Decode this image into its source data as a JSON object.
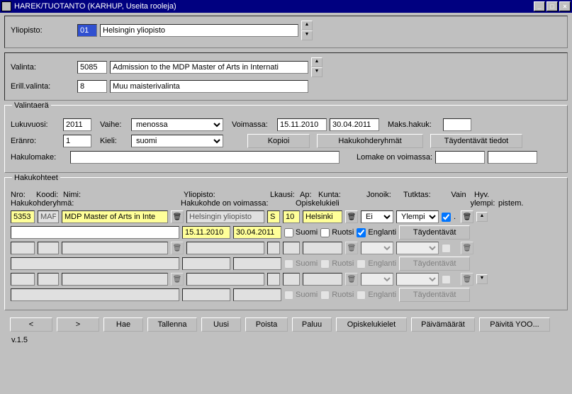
{
  "window": {
    "title": "HAREK/TUOTANTO   (KARHUP, Useita rooleja)"
  },
  "top": {
    "yliopisto_lbl": "Yliopisto:",
    "yliopisto_code": "01",
    "yliopisto_name": "Helsingin yliopisto",
    "valinta_lbl": "Valinta:",
    "valinta_code": "5085",
    "valinta_name": "Admission to the MDP Master of Arts in Internati",
    "erill_lbl": "Erill.valinta:",
    "erill_code": "8",
    "erill_name": "Muu maisterivalinta"
  },
  "valintaera": {
    "legend": "Valintaerä",
    "lukuvuosi_lbl": "Lukuvuosi:",
    "lukuvuosi": "2011",
    "vaihe_lbl": "Vaihe:",
    "vaihe": "menossa",
    "voimassa_lbl": "Voimassa:",
    "voimassa_from": "15.11.2010",
    "voimassa_to": "30.04.2011",
    "maks_lbl": "Maks.hakuk:",
    "maks": "",
    "eranro_lbl": "Eränro:",
    "eranro": "1",
    "kieli_lbl": "Kieli:",
    "kieli": "suomi",
    "kopioi": "Kopioi",
    "hakukohderyhmat": "Hakukohderyhmät",
    "taydentavat": "Täydentävät tiedot",
    "hakulomake_lbl": "Hakulomake:",
    "hakulomake": "",
    "lomake_lbl": "Lomake on voimassa:"
  },
  "hakukohteet": {
    "legend": "Hakukohteet",
    "hdr": {
      "nro": "Nro:",
      "koodi": "Koodi:",
      "nimi": "Nimi:",
      "yliopisto": "Yliopisto:",
      "lkausi": "Lkausi:",
      "ap": "Ap:",
      "kunta": "Kunta:",
      "jonoik": "Jonoik:",
      "tutktas": "Tutktas:",
      "vain": "Vain",
      "ylempi": "ylempi:",
      "hyv": "Hyv.",
      "pistem": "pistem."
    },
    "sub": {
      "hakukohderyhma": "Hakukohderyhmä:",
      "hakukohde_voim": "Hakukohde on voimassa:",
      "opiskelukieli": "Opiskelukieli"
    },
    "row1": {
      "nro": "5353",
      "koodi": "MAP",
      "nimi": "MDP Master of Arts in Inte",
      "yliopisto": "Helsingin yliopisto",
      "lkausi": "S",
      "ap": "10",
      "kunta": "Helsinki",
      "jonoik": "Ei",
      "tutktas": "Ylempi"
    },
    "row2": {
      "from": "15.11.2010",
      "to": "30.04.2011",
      "suomi": "Suomi",
      "ruotsi": "Ruotsi",
      "englanti": "Englanti",
      "tayd": "Täydentävät"
    },
    "disabled": {
      "suomi": "Suomi",
      "ruotsi": "Ruotsi",
      "englanti": "Englanti",
      "tayd": "Täydentävät"
    }
  },
  "bottom": {
    "prev": "<",
    "next": ">",
    "hae": "Hae",
    "tallenna": "Tallenna",
    "uusi": "Uusi",
    "poista": "Poista",
    "paluu": "Paluu",
    "opiskelukielet": "Opiskelukielet",
    "paivamaarat": "Päivämäärät",
    "paivita": "Päivitä YOO..."
  },
  "status": "v.1.5"
}
